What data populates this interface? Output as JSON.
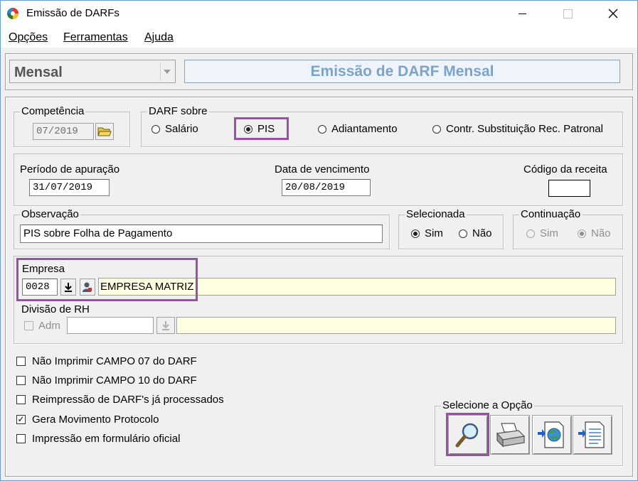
{
  "window": {
    "title": "Emissão de DARFs"
  },
  "menu": {
    "items": [
      {
        "label": "Opções"
      },
      {
        "label": "Ferramentas"
      },
      {
        "label": "Ajuda"
      }
    ]
  },
  "header": {
    "mode_select": "Mensal",
    "banner": "Emissão de DARF Mensal"
  },
  "competencia": {
    "title": "Competência",
    "value": "07/2019"
  },
  "darf_sobre": {
    "title": "DARF sobre",
    "options": [
      "Salário",
      "PIS",
      "Adiantamento",
      "Contr. Substituição Rec. Patronal"
    ],
    "selected": "PIS"
  },
  "periodo": {
    "label": "Período de apuração",
    "value": "31/07/2019"
  },
  "vencimento": {
    "label": "Data de vencimento",
    "value": "20/08/2019"
  },
  "codigo_receita": {
    "label": "Código da receita",
    "value": ""
  },
  "observacao": {
    "title": "Observação",
    "value": "PIS sobre Folha de Pagamento"
  },
  "selecionada": {
    "title": "Selecionada",
    "sim": "Sim",
    "nao": "Não",
    "selected": "Sim"
  },
  "continuacao": {
    "title": "Continuação",
    "sim": "Sim",
    "nao": "Não",
    "selected": "Não"
  },
  "empresa": {
    "label": "Empresa",
    "code": "0028",
    "name": "EMPRESA MATRIZ"
  },
  "divisao": {
    "label": "Divisão de RH",
    "adm_label": "Adm",
    "code": "",
    "name": ""
  },
  "options": [
    {
      "label": "Não Imprimir CAMPO 07 do DARF",
      "checked": false
    },
    {
      "label": "Não Imprimir CAMPO 10 do DARF",
      "checked": false
    },
    {
      "label": "Reimpressão de DARF's já processados",
      "checked": false
    },
    {
      "label": "Gera Movimento Protocolo",
      "checked": true
    },
    {
      "label": "Impressão em formulário oficial",
      "checked": false
    }
  ],
  "actions": {
    "title": "Selecione a Opção",
    "icons": [
      "preview-icon",
      "printer-icon",
      "export-globe-icon",
      "export-document-icon"
    ]
  },
  "colors": {
    "highlight": "#9b4fa8",
    "banner_text": "#7ca3c9",
    "yellow_field": "#ffffe1"
  }
}
